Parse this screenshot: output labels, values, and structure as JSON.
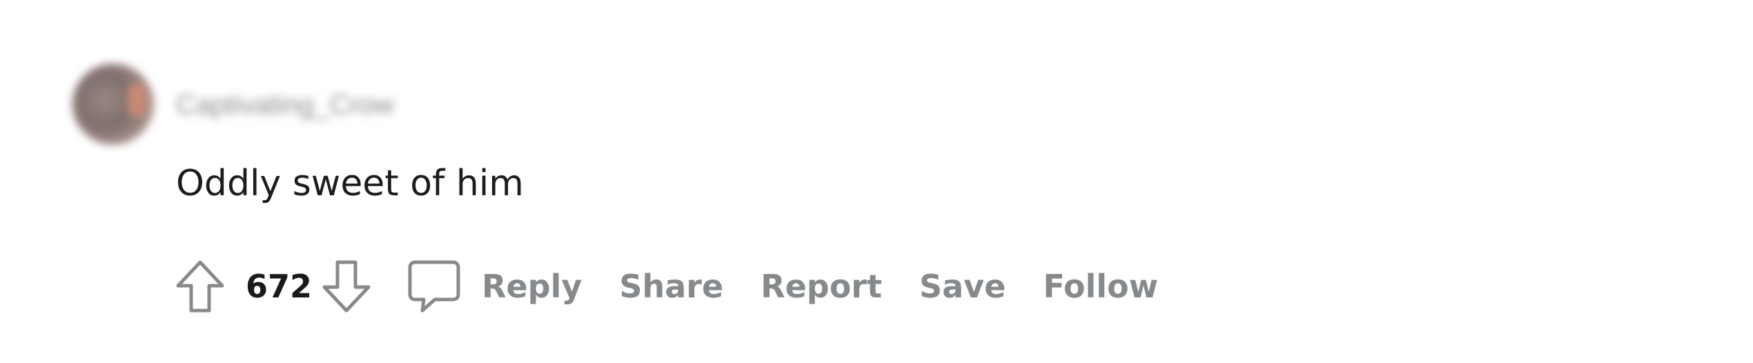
{
  "comment": {
    "username": "Captivating_Crow",
    "text": "Oddly sweet of him",
    "score": "672"
  },
  "actions": {
    "reply": "Reply",
    "share": "Share",
    "report": "Report",
    "save": "Save",
    "follow": "Follow"
  },
  "icons": {
    "upvote": "upvote-arrow-icon",
    "downvote": "downvote-arrow-icon",
    "comment": "speech-bubble-icon"
  },
  "colors": {
    "text": "#1c1c1c",
    "action": "#878a8c",
    "icon": "#878a8c"
  }
}
